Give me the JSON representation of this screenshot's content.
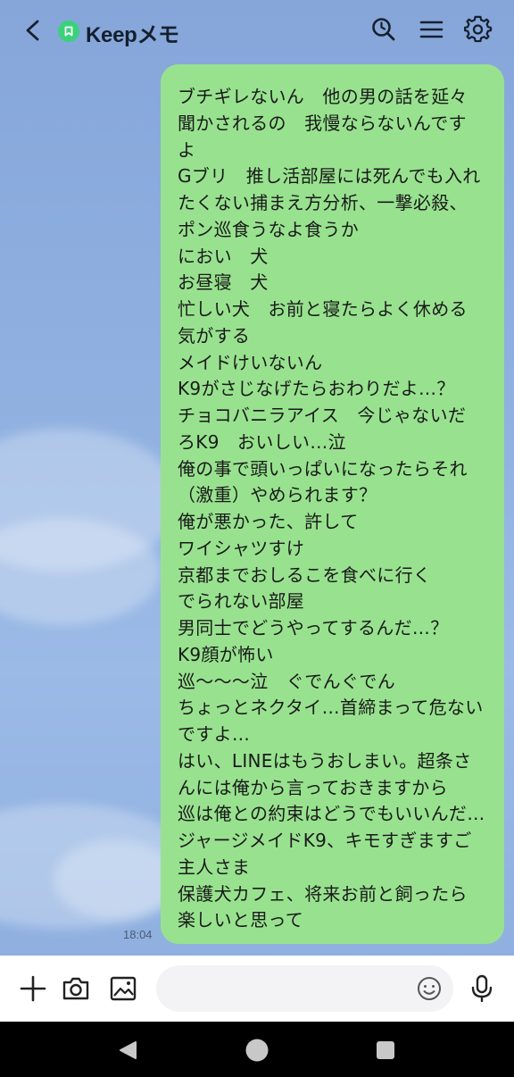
{
  "header": {
    "title": "Keepメモ",
    "icons": [
      "back-icon",
      "keep-badge-icon",
      "search-icon",
      "menu-icon",
      "settings-icon"
    ]
  },
  "message": {
    "lines": [
      "ブチギレないん　他の男の話を延々",
      "聞かされるの　我慢ならないんです",
      "よ",
      "Gブリ　推し活部屋には死んでも入れ",
      "たくない捕まえ方分析、一撃必殺、",
      "ポン巡食うなよ食うか",
      "におい　犬",
      "お昼寝　犬",
      "忙しい犬　お前と寝たらよく休める",
      "気がする",
      "メイドけいないん",
      "K9がさじなげたらおわりだよ…？",
      "チョコバニラアイス　今じゃないだ",
      "ろK9　おいしい…泣",
      "俺の事で頭いっぱいになったらそれ",
      "（激重）やめられます？",
      "俺が悪かった、許して",
      "ワイシャツすけ",
      "京都までおしるこを食べに行く",
      "でられない部屋",
      "男同士でどうやってするんだ…？",
      "K9顔が怖い",
      "巡〜〜〜泣　ぐでんぐでん",
      "ちょっとネクタイ…首締まって危ない",
      "ですよ…",
      "はい、LINEはもうおしまい。超条さ",
      "んには俺から言っておきますから",
      "巡は俺との約束はどうでもいいんだ…",
      "ジャージメイドK9、キモすぎますご",
      "主人さま",
      "保護犬カフェ、将来お前と飼ったら",
      "楽しいと思って"
    ],
    "time": "18:04"
  },
  "input_bar": {
    "placeholder": "",
    "value": "",
    "icons": [
      "plus-icon",
      "camera-icon",
      "image-icon",
      "emoji-icon",
      "mic-icon"
    ]
  },
  "colors": {
    "chat_background": "#8aa9dc",
    "bubble": "#98e28f",
    "badge": "#3ad17a",
    "nav_bar": "#000000"
  },
  "navigation": {
    "icons": [
      "nav-back-icon",
      "nav-home-icon",
      "nav-recents-icon"
    ]
  }
}
